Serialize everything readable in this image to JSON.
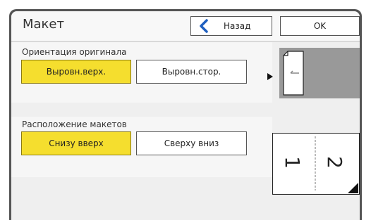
{
  "header": {
    "title": "Макет",
    "back_label": "Назад",
    "ok_label": "OK"
  },
  "orientation": {
    "label": "Ориентация оригинала",
    "options": [
      "Выровн.верх.",
      "Выровн.стор."
    ],
    "selected": "Выровн.верх."
  },
  "layout": {
    "label": "Расположение макетов",
    "options": [
      "Снизу вверх",
      "Сверху вниз"
    ],
    "selected": "Снизу вверх"
  },
  "preview_layout": {
    "page_labels": [
      "1",
      "2"
    ]
  },
  "colors": {
    "selected": "#f5de2e",
    "accent": "#1f5fbf",
    "preview_bg": "#999999"
  }
}
